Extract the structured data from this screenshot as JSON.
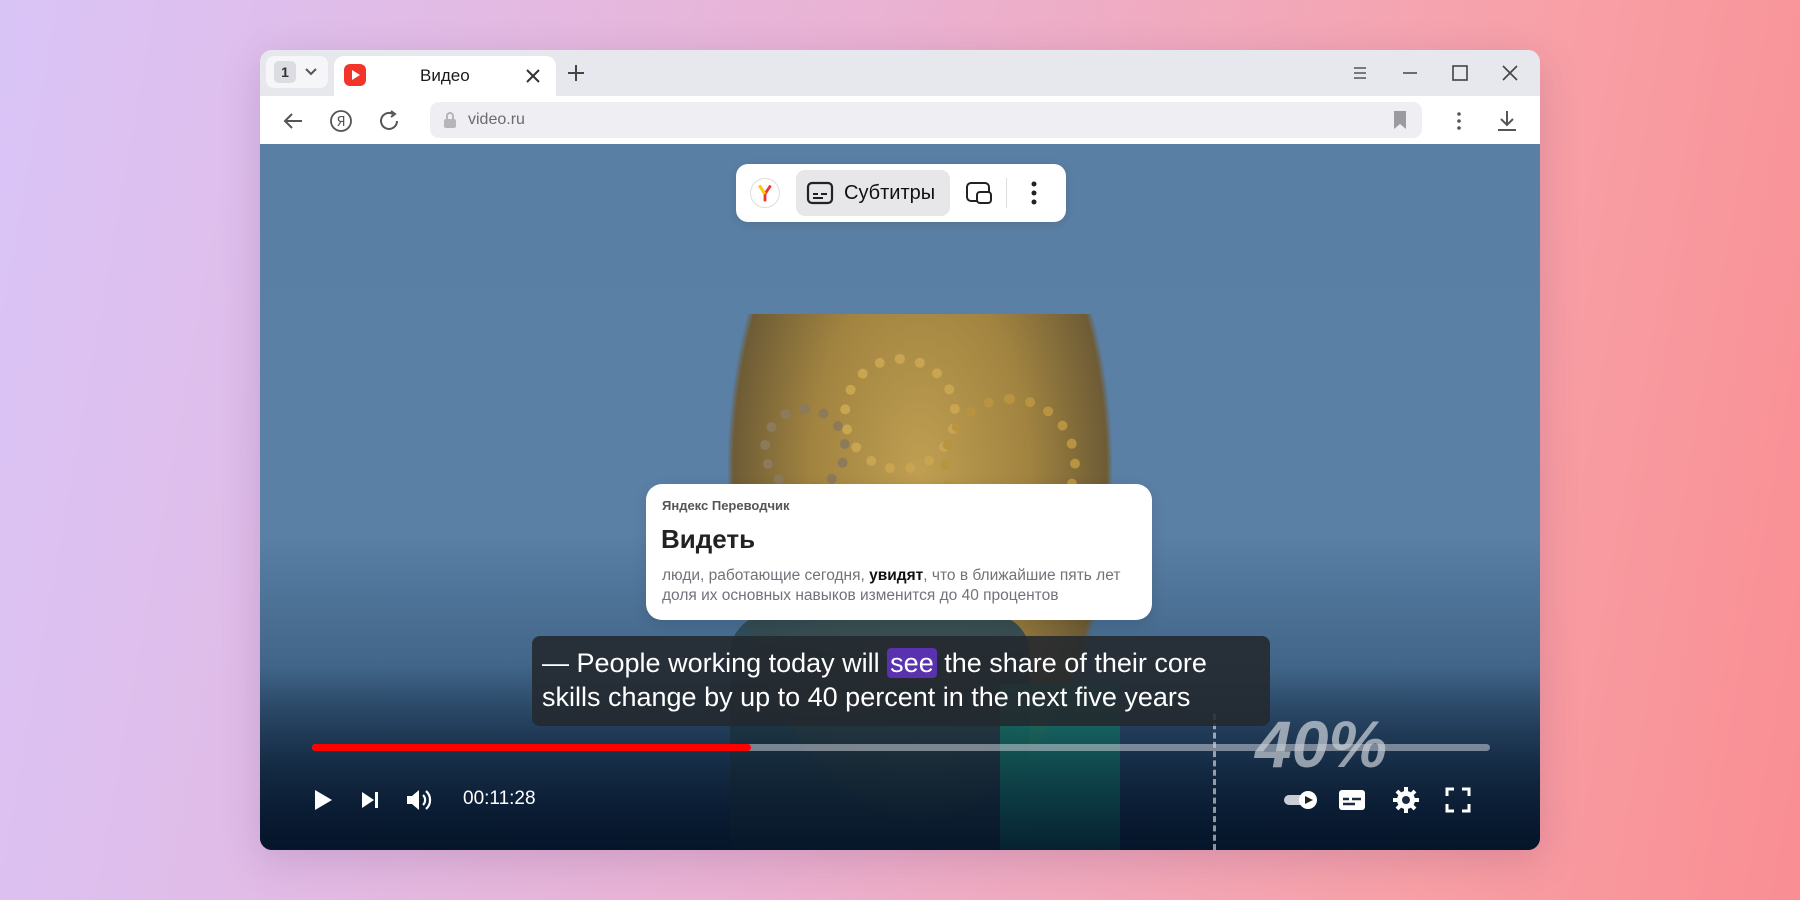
{
  "browser": {
    "tab_count": "1",
    "tab_title": "Видео",
    "url": "video.ru"
  },
  "toolbar_pill": {
    "subtitles_label": "Субтитры"
  },
  "translator": {
    "source": "Яндекс Переводчик",
    "word": "Видеть",
    "context_before": "люди, работающие сегодня, ",
    "context_bold": "увидят",
    "context_after": ", что в ближайшие пять лет доля их основных навыков изменится до 40 процентов"
  },
  "subtitle": {
    "before": "— People working today will ",
    "highlight": "see",
    "after": " the share of their core skills change by up to 40 percent in the next five years"
  },
  "video": {
    "overlay_text": "40%",
    "time": "00:11:28",
    "progress_fraction": 0.373
  },
  "colors": {
    "progress": "#ff0000",
    "highlight": "#5a32b0",
    "favicon": "#f2352a"
  },
  "icons": [
    "chevron-down-icon",
    "video-favicon-icon",
    "close-icon",
    "plus-icon",
    "menu-icon",
    "minimize-icon",
    "maximize-icon",
    "back-icon",
    "yandex-icon",
    "reload-icon",
    "lock-icon",
    "bookmark-icon",
    "kebab-icon",
    "download-icon",
    "subtitles-icon",
    "pip-icon",
    "play-icon",
    "next-icon",
    "volume-icon",
    "autoplay-icon",
    "settings-icon",
    "fullscreen-icon"
  ]
}
